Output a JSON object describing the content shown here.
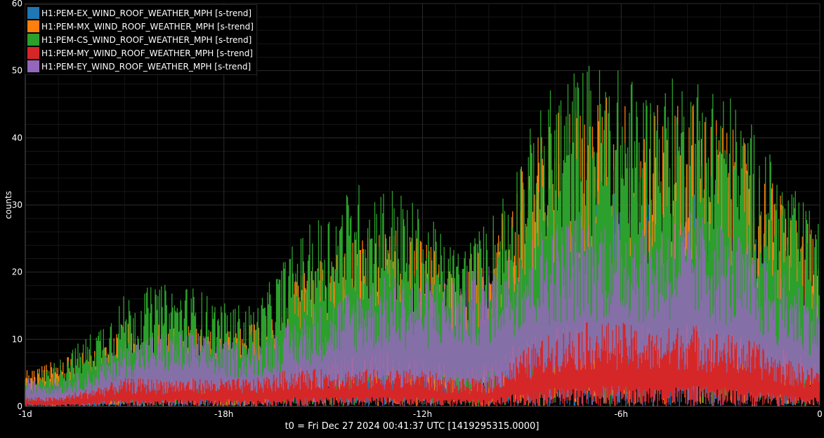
{
  "chart_data": {
    "type": "area",
    "title": "",
    "xlabel": "t0 = Fri Dec 27 2024 00:41:37 UTC [1419295315.0000]",
    "ylabel": "counts",
    "x_unit": "hours relative to t0",
    "xlim": [
      -24,
      0
    ],
    "ylim": [
      0,
      60
    ],
    "x_ticks": [
      -24,
      -18,
      -12,
      -6,
      0
    ],
    "x_tick_labels": [
      "-1d",
      "-18h",
      "-12h",
      "-6h",
      "0"
    ],
    "y_ticks": [
      0,
      10,
      20,
      30,
      40,
      50,
      60
    ],
    "y_tick_labels": [
      "0",
      "10",
      "20",
      "30",
      "40",
      "50",
      "60"
    ],
    "grid": true,
    "legend_position": "top-left",
    "x": [
      -24,
      -23,
      -22,
      -21,
      -20,
      -19,
      -18,
      -17,
      -16,
      -15,
      -14,
      -13,
      -12,
      -11,
      -10,
      -9,
      -8,
      -7,
      -6,
      -5,
      -4,
      -3,
      -2,
      -1,
      0
    ],
    "series": [
      {
        "name": "H1:PEM-EX_WIND_ROOF_WEATHER_MPH [s-trend]",
        "color": "#1f77b4",
        "values": [
          2,
          2,
          1,
          2,
          3,
          4,
          4,
          5,
          7,
          10,
          12,
          12,
          11,
          9,
          12,
          17,
          20,
          22,
          23,
          22,
          24,
          22,
          19,
          15,
          13
        ]
      },
      {
        "name": "H1:PEM-MX_WIND_ROOF_WEATHER_MPH [s-trend]",
        "color": "#ff7f0e",
        "values": [
          4,
          5,
          6,
          9,
          9,
          9,
          8,
          9,
          13,
          16,
          18,
          19,
          18,
          15,
          18,
          26,
          32,
          34,
          33,
          32,
          33,
          31,
          27,
          22,
          18
        ]
      },
      {
        "name": "H1:PEM-CS_WIND_ROOF_WEATHER_MPH [s-trend]",
        "color": "#2ca02c",
        "values": [
          3,
          5,
          8,
          12,
          13,
          13,
          11,
          11,
          17,
          21,
          24,
          24,
          21,
          17,
          20,
          28,
          35,
          37,
          36,
          34,
          36,
          35,
          30,
          24,
          20
        ]
      },
      {
        "name": "H1:PEM-MY_WIND_ROOF_WEATHER_MPH [s-trend]",
        "color": "#d62728",
        "values": [
          1,
          1,
          2,
          3,
          3,
          3,
          3,
          3,
          4,
          4,
          4,
          4,
          4,
          3,
          3,
          6,
          8,
          9,
          9,
          8,
          9,
          8,
          7,
          5,
          4
        ]
      },
      {
        "name": "H1:PEM-EY_WIND_ROOF_WEATHER_MPH [s-trend]",
        "color": "#9467bd",
        "values": [
          3,
          3,
          4,
          7,
          8,
          8,
          7,
          7,
          9,
          11,
          13,
          14,
          14,
          14,
          15,
          18,
          20,
          21,
          21,
          20,
          21,
          20,
          17,
          14,
          12
        ]
      }
    ]
  }
}
